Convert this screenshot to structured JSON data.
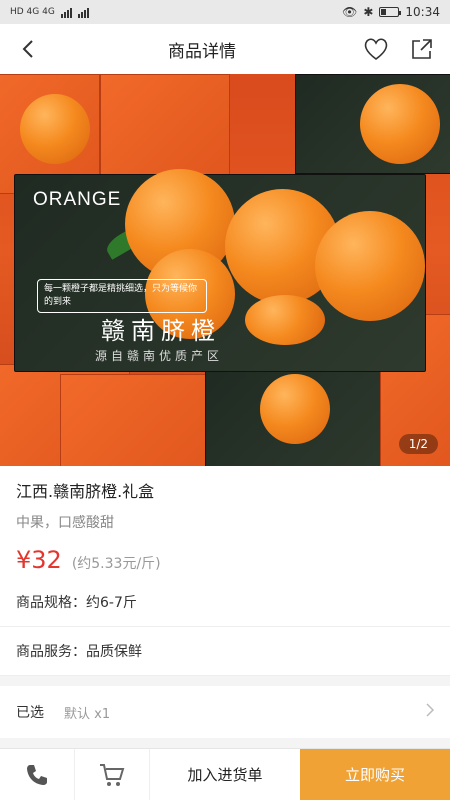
{
  "status_bar": {
    "left": "HD 4G 4G",
    "time": "10:34"
  },
  "nav": {
    "title": "商品详情",
    "back_icon": "chevron-left-icon",
    "favorite_icon": "heart-icon",
    "share_icon": "share-icon"
  },
  "hero": {
    "brand": "ORANGE",
    "box_title": "赣南脐橙",
    "box_subtitle": "源自赣南优质产区",
    "box_tag": "每一颗橙子都是精挑细选，只为等候你的到来",
    "counter": "1/2"
  },
  "product": {
    "name": "江西.赣南脐橙.礼盒",
    "desc": "中果，口感酸甜",
    "price": "¥32",
    "unit_price": "(约5.33元/斤)",
    "spec_label": "商品规格：",
    "spec_value": "约6-7斤",
    "service_label": "商品服务：",
    "service_value": "品质保鲜"
  },
  "selected": {
    "label": "已选",
    "value": "默认 x1",
    "arrow_icon": "chevron-right-icon"
  },
  "bottom": {
    "phone_icon": "phone-icon",
    "cart_icon": "cart-icon",
    "add_label": "加入进货单",
    "buy_label": "立即购买"
  },
  "colors": {
    "price": "#e3362e",
    "buy_button": "#f0a235"
  }
}
